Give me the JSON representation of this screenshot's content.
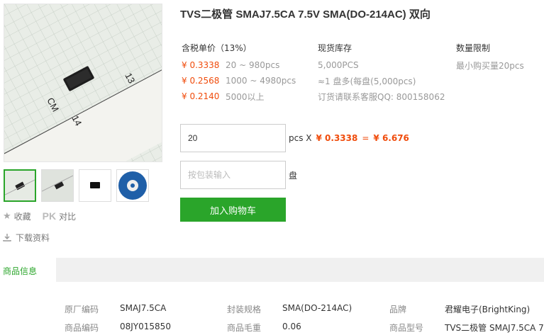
{
  "product": {
    "title": "TVS二极管 SMAJ7.5CA 7.5V SMA(DO-214AC) 双向"
  },
  "price": {
    "header": "含税单价（13%）",
    "rows": [
      {
        "price": "¥ 0.3338",
        "range": "20 ~ 980pcs"
      },
      {
        "price": "¥ 0.2568",
        "range": "1000 ~ 4980pcs"
      },
      {
        "price": "¥ 0.2140",
        "range": "5000以上"
      }
    ]
  },
  "stock": {
    "header": "现货库存",
    "qty": "5,000PCS",
    "reel": "≈1 盘多(每盘(5,000pcs)",
    "contact": "订货请联系客服QQ: 800158062"
  },
  "limit": {
    "header": "数量限制",
    "text": "最小购买量20pcs"
  },
  "order": {
    "qty_value": "20",
    "unit": "pcs X",
    "unit_price": "¥ 0.3338",
    "equals": "=",
    "total": "¥ 6.676",
    "pack_placeholder": "按包装输入",
    "pack_unit": "盘",
    "cart_label": "加入购物车"
  },
  "tools": {
    "favorite": "收藏",
    "pk_mark": "PK",
    "compare": "对比",
    "download": "下载资料"
  },
  "tabs": {
    "info": "商品信息"
  },
  "details": [
    {
      "label": "原厂编码",
      "value": "SMAJ7.5CA"
    },
    {
      "label": "封装规格",
      "value": "SMA(DO-214AC)"
    },
    {
      "label": "品牌",
      "value": "君耀电子(BrightKing)"
    },
    {
      "label": "商品编码",
      "value": "08JY015850"
    },
    {
      "label": "商品毛重",
      "value": "0.06"
    },
    {
      "label": "商品型号",
      "value": "TVS二极管 SMAJ7.5CA 7..."
    }
  ],
  "ruler_marks": [
    "13",
    "CM",
    "14"
  ],
  "colors": {
    "accent_green": "#2aa52a",
    "price_orange": "#f04c0c"
  }
}
